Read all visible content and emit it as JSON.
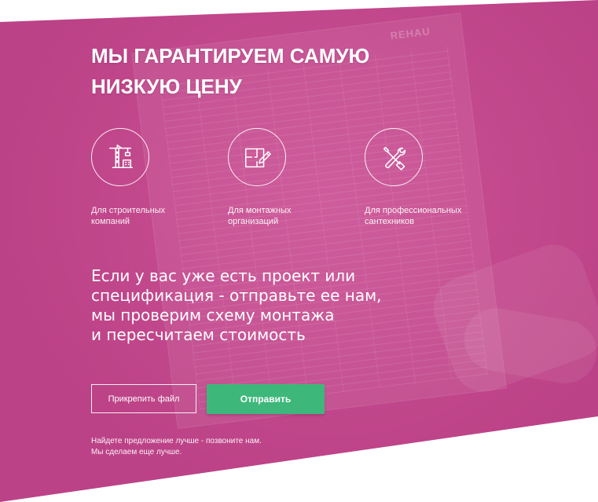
{
  "hero": {
    "background_color": "#c8468f",
    "watermark_logo": "REHAU",
    "title_line1": "МЫ ГАРАНТИРУЕМ САМУЮ",
    "title_line2": "НИЗКУЮ ЦЕНУ"
  },
  "features": [
    {
      "icon": "crane-building-icon",
      "label": "Для строительных\nкомпаний"
    },
    {
      "icon": "floor-plan-pencil-icon",
      "label": "Для монтажных\nорганизаций"
    },
    {
      "icon": "wrench-screwdriver-icon",
      "label": "Для профессиональных\nсантехников"
    }
  ],
  "lead_text": "Если у вас уже есть проект или\nспецификация - отправьте ее нам,\nмы проверим схему монтажа\nи пересчитаем стоимость",
  "actions": {
    "attach_label": "Прикрепить файл",
    "send_label": "Отправить",
    "send_color": "#3db87a"
  },
  "footnote": {
    "line1": "Найдете предложение лучше - позвоните нам.",
    "line2": "Мы сделаем еще лучше."
  }
}
